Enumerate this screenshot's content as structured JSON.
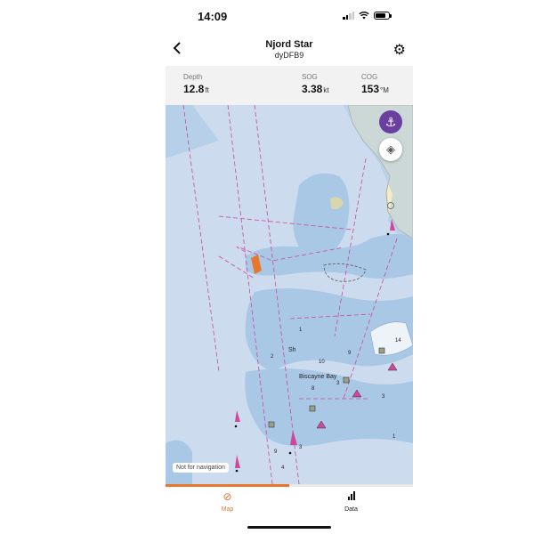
{
  "status_bar": {
    "time": "14:09"
  },
  "header": {
    "vessel_name": "Njord Star",
    "vessel_id": "dyDFB9",
    "back_icon": "chevron-left-icon",
    "settings_icon": "gear-icon"
  },
  "metrics": [
    {
      "label": "Depth",
      "value": "12.8",
      "unit": "ft"
    },
    {
      "label": "SOG",
      "value": "3.38",
      "unit": "kt"
    },
    {
      "label": "COG",
      "value": "153",
      "unit": "°M"
    }
  ],
  "map": {
    "anchor_icon": "anchor-icon",
    "layers_icon": "layers-icon",
    "place_label": "Biscayne Bay",
    "sh_label": "Sh",
    "not_for_navigation": "Not for navigation",
    "soundings": [
      "1",
      "2",
      "9",
      "3",
      "3",
      "1",
      "9",
      "3",
      "4",
      "14",
      "8",
      "10"
    ]
  },
  "tabs": [
    {
      "label": "Map",
      "icon": "compass-icon",
      "active": true
    },
    {
      "label": "Data",
      "icon": "bar-chart-icon",
      "active": false
    }
  ],
  "colors": {
    "accent": "#e8772e",
    "anchor": "#6b3fa0"
  }
}
